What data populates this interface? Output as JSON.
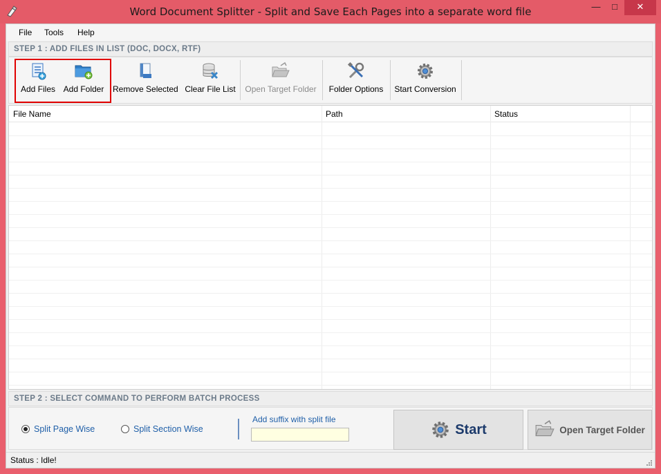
{
  "window": {
    "title": "Word Document Splitter - Split and Save Each Pages into a separate word file",
    "minimize": "—",
    "maximize": "□",
    "close": "✕"
  },
  "menu": [
    "File",
    "Tools",
    "Help"
  ],
  "step1": {
    "label": "STEP 1 : ADD FILES IN LIST (DOC, DOCX, RTF)"
  },
  "toolbar": {
    "add_files": {
      "label": "Add Files",
      "icon": "add-files-icon"
    },
    "add_folder": {
      "label": "Add Folder",
      "icon": "add-folder-icon"
    },
    "remove_selected": {
      "label": "Remove Selected",
      "icon": "remove-file-icon"
    },
    "clear_list": {
      "label": "Clear File List",
      "icon": "database-delete-icon"
    },
    "open_target": {
      "label": "Open Target Folder",
      "icon": "open-folder-icon"
    },
    "folder_options": {
      "label": "Folder Options",
      "icon": "tools-icon"
    },
    "start_conversion": {
      "label": "Start Conversion",
      "icon": "gear-icon"
    }
  },
  "grid": {
    "columns": [
      "File Name",
      "Path",
      "Status"
    ],
    "rows": []
  },
  "step2": {
    "label": "STEP 2 : SELECT COMMAND TO PERFORM BATCH PROCESS"
  },
  "options": {
    "split_page": {
      "label": "Split Page Wise",
      "selected": true
    },
    "split_section": {
      "label": "Split Section Wise",
      "selected": false
    }
  },
  "suffix": {
    "label": "Add suffix with split file",
    "value": ""
  },
  "buttons": {
    "start": "Start",
    "open_target": "Open Target Folder"
  },
  "status": {
    "text": "Status  :  Idle!"
  },
  "colors": {
    "title_bar": "#e45b68",
    "highlight": "#e00000",
    "link_blue": "#1f5fa8",
    "step_text": "#6b7a89"
  }
}
